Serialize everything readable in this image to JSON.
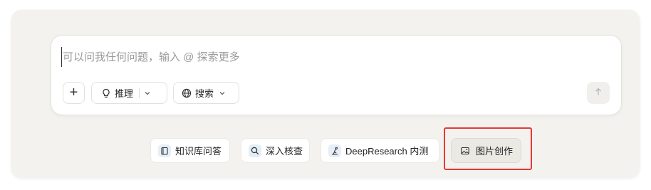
{
  "input": {
    "placeholder": "可以问我任何问题，输入 @ 探索更多",
    "value": ""
  },
  "toolbar": {
    "plus_label": "+",
    "reason_label": "推理",
    "search_label": "搜索"
  },
  "quick_actions": [
    {
      "label": "知识库问答",
      "icon": "book-icon"
    },
    {
      "label": "深入核查",
      "icon": "magnifier-icon"
    },
    {
      "label": "DeepResearch 内测",
      "icon": "research-icon"
    },
    {
      "label": "图片创作",
      "icon": "image-icon"
    }
  ],
  "colors": {
    "highlight": "#e53935",
    "panel": "#f4f2ee",
    "chip_selected": "#ebe9e4"
  }
}
